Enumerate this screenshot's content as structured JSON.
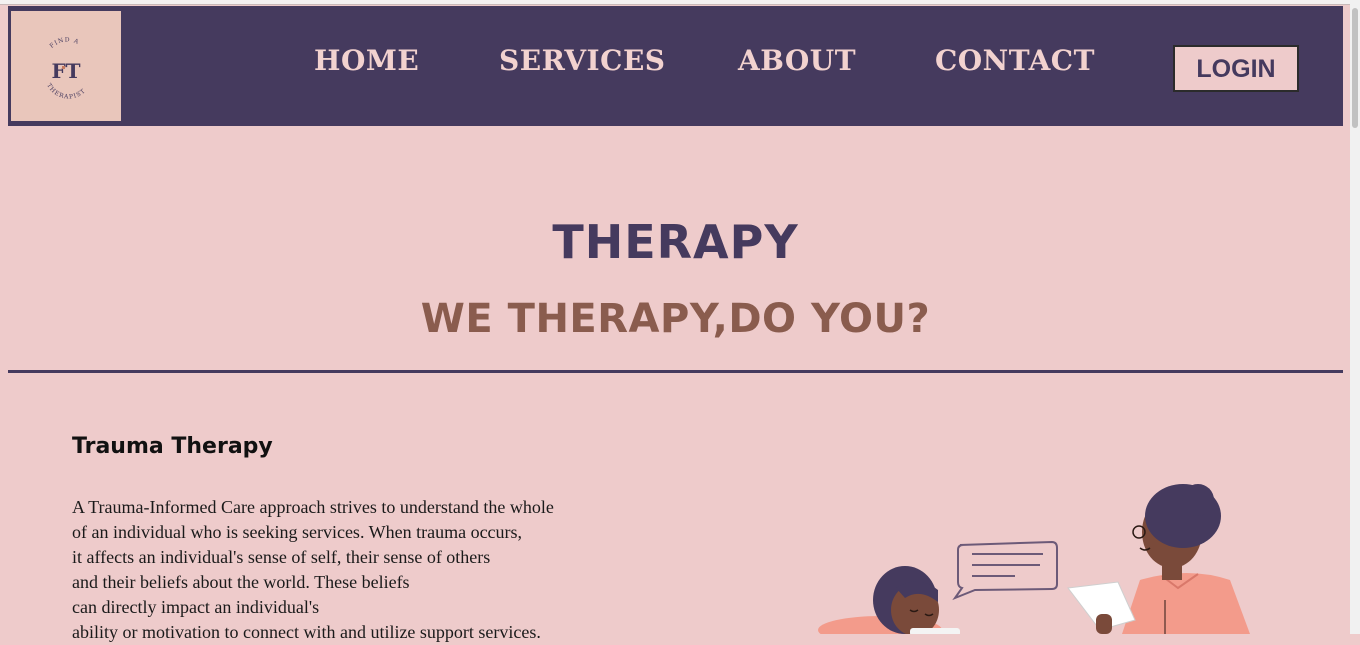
{
  "header": {
    "logo": {
      "top_text": "FIND A",
      "monogram": "FT",
      "bottom_text": "THERAPIST",
      "bg_color": "#e9c6bb"
    },
    "nav": [
      {
        "label": "HOME"
      },
      {
        "label": "SERVICES"
      },
      {
        "label": "ABOUT"
      },
      {
        "label": "CONTACT"
      }
    ],
    "login_label": "LOGIN",
    "bg_color": "#453a5e"
  },
  "hero": {
    "title": "THERAPY",
    "subtitle": "WE THERAPY,DO YOU?",
    "title_color": "#453a5e",
    "subtitle_color": "#8a5c4e"
  },
  "section": {
    "title": "Trauma Therapy",
    "body_lines": [
      "A Trauma-Informed Care approach strives to understand the whole",
      "of an individual who is seeking services. When trauma occurs,",
      "it affects an individual's sense of self, their sense of others",
      "and their beliefs about the world. These beliefs",
      "can directly impact an individual's",
      "ability or motivation to connect with and utilize support services."
    ]
  },
  "illustration": {
    "icon": "therapy-session-illustration"
  },
  "colors": {
    "page_bg": "#eecbcb",
    "accent": "#453a5e"
  }
}
